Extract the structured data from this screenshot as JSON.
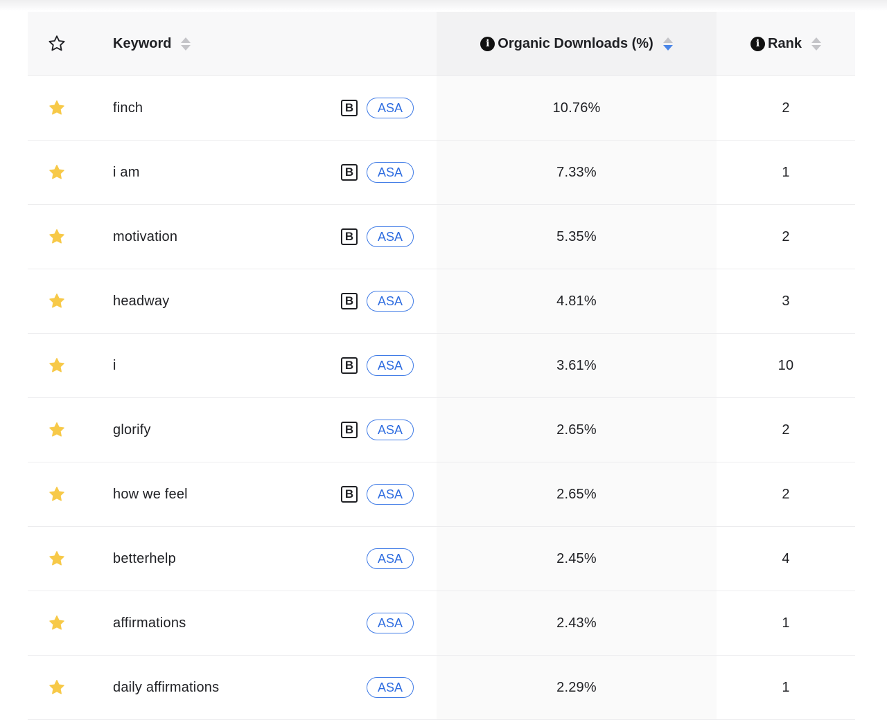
{
  "header": {
    "keyword_label": "Keyword",
    "organic_label": "Organic Downloads (%)",
    "rank_label": "Rank",
    "info_glyph": "i"
  },
  "colors": {
    "star_filled": "#f7c948",
    "asa_blue": "#2f6de0",
    "sort_active": "#4a86e8"
  },
  "badges": {
    "b_label": "B",
    "asa_label": "ASA"
  },
  "rows": [
    {
      "keyword": "finch",
      "has_b": true,
      "organic": "10.76%",
      "rank": "2"
    },
    {
      "keyword": "i am",
      "has_b": true,
      "organic": "7.33%",
      "rank": "1"
    },
    {
      "keyword": "motivation",
      "has_b": true,
      "organic": "5.35%",
      "rank": "2"
    },
    {
      "keyword": "headway",
      "has_b": true,
      "organic": "4.81%",
      "rank": "3"
    },
    {
      "keyword": "i",
      "has_b": true,
      "organic": "3.61%",
      "rank": "10"
    },
    {
      "keyword": "glorify",
      "has_b": true,
      "organic": "2.65%",
      "rank": "2"
    },
    {
      "keyword": "how we feel",
      "has_b": true,
      "organic": "2.65%",
      "rank": "2"
    },
    {
      "keyword": "betterhelp",
      "has_b": false,
      "organic": "2.45%",
      "rank": "4"
    },
    {
      "keyword": "affirmations",
      "has_b": false,
      "organic": "2.43%",
      "rank": "1"
    },
    {
      "keyword": "daily affirmations",
      "has_b": false,
      "organic": "2.29%",
      "rank": "1"
    }
  ]
}
